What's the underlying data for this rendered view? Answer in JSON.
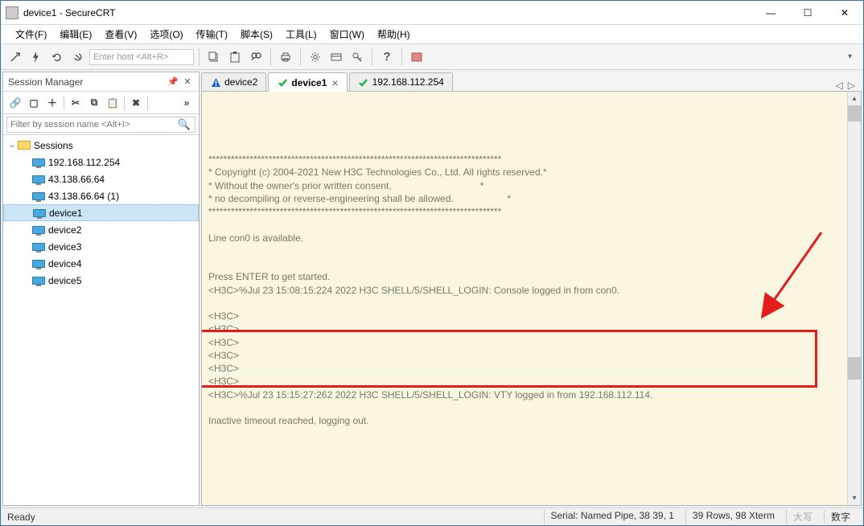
{
  "window": {
    "title": "device1 - SecureCRT"
  },
  "menu": [
    "文件(F)",
    "编辑(E)",
    "查看(V)",
    "选项(O)",
    "传输(T)",
    "脚本(S)",
    "工具(L)",
    "窗口(W)",
    "帮助(H)"
  ],
  "toolbar": {
    "placeholder": "Enter host <Alt+R>"
  },
  "session_manager": {
    "title": "Session Manager",
    "filter_placeholder": "Filter by session name <Alt+I>",
    "root": "Sessions",
    "items": [
      {
        "label": "192.168.112.254"
      },
      {
        "label": "43.138.66.64"
      },
      {
        "label": "43.138.66.64 (1)"
      },
      {
        "label": "device1",
        "selected": true
      },
      {
        "label": "device2"
      },
      {
        "label": "device3"
      },
      {
        "label": "device4"
      },
      {
        "label": "device5"
      }
    ]
  },
  "tabs": [
    {
      "label": "device2",
      "icon": "warn"
    },
    {
      "label": "device1",
      "icon": "ok",
      "active": true,
      "closable": true
    },
    {
      "label": "192.168.112.254",
      "icon": "ok"
    }
  ],
  "terminal": {
    "text": "******************************************************************************\n* Copyright (c) 2004-2021 New H3C Technologies Co., Ltd. All rights reserved.*\n* Without the owner's prior written consent,                                 *\n* no decompiling or reverse-engineering shall be allowed.                    *\n******************************************************************************\n\nLine con0 is available.\n\n\nPress ENTER to get started.\n<H3C>%Jul 23 15:08:15:224 2022 H3C SHELL/5/SHELL_LOGIN: Console logged in from con0.\n\n<H3C>\n<H3C>\n<H3C>\n<H3C>\n<H3C>\n<H3C>\n<H3C>%Jul 23 15:15:27:262 2022 H3C SHELL/5/SHELL_LOGIN: VTY logged in from 192.168.112.114.\n\nInactive timeout reached, logging out."
  },
  "status": {
    "left": "Ready",
    "serial": "Serial: Named Pipe, 38  39,   1",
    "dims": "39 Rows, 98 Xterm",
    "caps": "大写",
    "num": "数字"
  }
}
